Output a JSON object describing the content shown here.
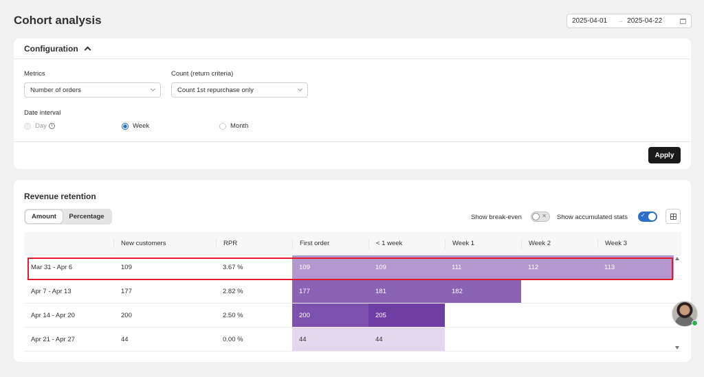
{
  "page": {
    "title": "Cohort analysis"
  },
  "date_range": {
    "start": "2025-04-01",
    "end": "2025-04-22",
    "separator": "→"
  },
  "config": {
    "title": "Configuration",
    "metrics_label": "Metrics",
    "metrics_value": "Number of orders",
    "count_label": "Count (return criteria)",
    "count_value": "Count 1st repurchase only",
    "interval_label": "Date interval",
    "interval_options": [
      {
        "label": "Day",
        "state": "disabled"
      },
      {
        "label": "Week",
        "state": "checked"
      },
      {
        "label": "Month",
        "state": "unchecked"
      }
    ],
    "apply_label": "Apply"
  },
  "retention": {
    "title": "Revenue retention",
    "view_tabs": [
      "Amount",
      "Percentage"
    ],
    "active_tab": "Amount",
    "break_even_label": "Show break-even",
    "break_even_on": false,
    "accumulated_label": "Show accumulated stats",
    "accumulated_on": true,
    "columns": [
      "",
      "New customers",
      "RPR",
      "First order",
      "< 1 week",
      "Week 1",
      "Week 2",
      "Week 3"
    ],
    "rows": [
      {
        "cohort": "Mar 31 - Apr 6",
        "new_customers": "109",
        "rpr": "3.67 %",
        "values": [
          "109",
          "109",
          "111",
          "112",
          "113"
        ]
      },
      {
        "cohort": "Apr 7 - Apr 13",
        "new_customers": "177",
        "rpr": "2.82 %",
        "values": [
          "177",
          "181",
          "182"
        ]
      },
      {
        "cohort": "Apr 14 - Apr 20",
        "new_customers": "200",
        "rpr": "2.50 %",
        "values": [
          "200",
          "205"
        ]
      },
      {
        "cohort": "Apr 21 - Apr 27",
        "new_customers": "44",
        "rpr": "0.00 %",
        "values": [
          "44",
          "44"
        ]
      }
    ]
  },
  "colors": {
    "heat_row1": "#b398cf",
    "heat_row2": "#8b63b5",
    "heat_row3_a": "#7d52ae",
    "heat_row3_b": "#6f3ea3",
    "heat_row4": "#e3d7ee",
    "highlight": "#e2182d",
    "accent": "#2c6ecb"
  }
}
